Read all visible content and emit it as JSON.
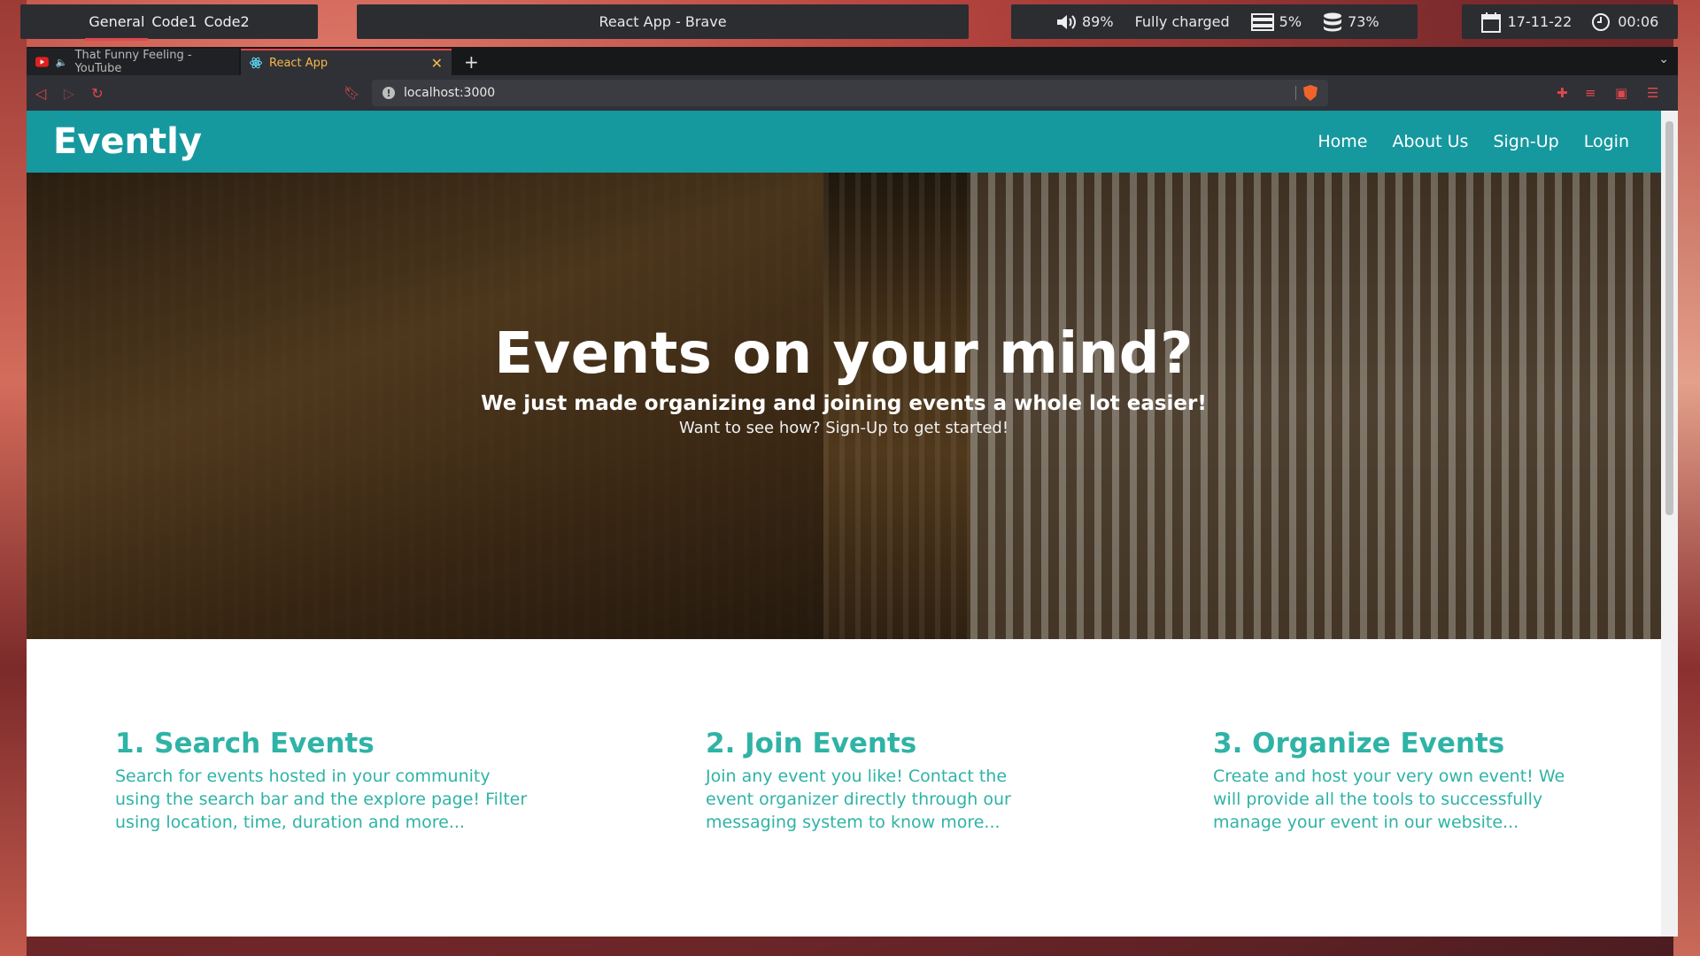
{
  "topbar": {
    "workspaces": [
      "General",
      "Code1",
      "Code2"
    ],
    "active_workspace": "General",
    "window_title": "React App - Brave",
    "volume": "89%",
    "battery": "Fully charged",
    "memory": "5%",
    "disk": "73%",
    "date": "17-11-22",
    "time": "00:06"
  },
  "browser": {
    "tabs": [
      {
        "title": "That Funny Feeling - YouTube"
      },
      {
        "title": "React App"
      }
    ],
    "url": "localhost:3000"
  },
  "site": {
    "brand": "Evently",
    "nav": [
      "Home",
      "About Us",
      "Sign-Up",
      "Login"
    ],
    "hero": {
      "title": "Events on your mind?",
      "subtitle": "We just made organizing and joining events a whole lot easier!",
      "tagline": "Want to see how? Sign-Up to get started!"
    },
    "features": [
      {
        "title": "1. Search Events",
        "text": "Search for events hosted in your community using the search bar and the explore page! Filter using location, time, duration and more..."
      },
      {
        "title": "2. Join Events",
        "text": "Join any event you like! Contact the event organizer directly through our messaging system to know more..."
      },
      {
        "title": "3. Organize Events",
        "text": "Create and host your very own event! We will provide all the tools to successfully manage your event in our website..."
      }
    ],
    "colors": {
      "navbar": "#16989f",
      "feature_text": "#2fb3a6",
      "accent": "#e0474c"
    }
  }
}
